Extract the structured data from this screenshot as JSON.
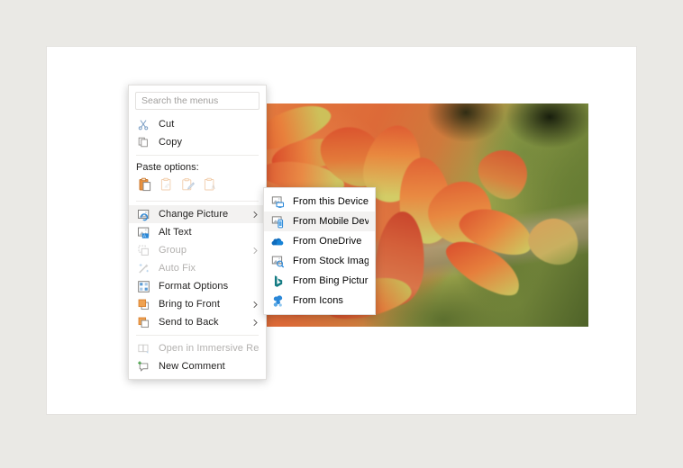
{
  "app": {
    "surface_color": "#eae9e5",
    "page_color": "#ffffff",
    "accent_blue": "#0078d4",
    "hover_gray": "#f3f2f1"
  },
  "picture": {
    "alt": "Close-up photograph of orange-red tipped succulent plants with blurred green foliage background",
    "selected": true
  },
  "context_menu": {
    "search": {
      "placeholder": "Search the menus",
      "value": ""
    },
    "items": [
      {
        "label": "Cut",
        "icon": "scissors-icon",
        "disabled": false,
        "submenu": false,
        "hovered": false
      },
      {
        "label": "Copy",
        "icon": "copy-icon",
        "disabled": false,
        "submenu": false,
        "hovered": false
      }
    ],
    "paste_options": {
      "label": "Paste options:",
      "buttons": [
        {
          "name": "paste-keep-source-formatting",
          "icon": "clipboard-paste-icon",
          "disabled": false
        },
        {
          "name": "paste-merge-formatting",
          "icon": "clipboard-merge-icon",
          "disabled": true
        },
        {
          "name": "paste-picture",
          "icon": "clipboard-picture-icon",
          "disabled": true
        },
        {
          "name": "paste-keep-text-only",
          "icon": "clipboard-text-icon",
          "disabled": true
        }
      ]
    },
    "actions": [
      {
        "label": "Change Picture",
        "icon": "change-picture-icon",
        "disabled": false,
        "submenu": true,
        "hovered": true
      },
      {
        "label": "Alt Text",
        "icon": "alt-text-icon",
        "disabled": false,
        "submenu": false,
        "hovered": false
      },
      {
        "label": "Group",
        "icon": "group-icon",
        "disabled": true,
        "submenu": true,
        "hovered": false
      },
      {
        "label": "Auto Fix",
        "icon": "auto-fix-icon",
        "disabled": true,
        "submenu": false,
        "hovered": false
      },
      {
        "label": "Format Options",
        "icon": "format-options-icon",
        "disabled": false,
        "submenu": false,
        "hovered": false
      },
      {
        "label": "Bring to Front",
        "icon": "bring-to-front-icon",
        "disabled": false,
        "submenu": true,
        "hovered": false
      },
      {
        "label": "Send to Back",
        "icon": "send-to-back-icon",
        "disabled": false,
        "submenu": true,
        "hovered": false
      }
    ],
    "footer": [
      {
        "label": "Open in Immersive Reader",
        "icon": "immersive-reader-icon",
        "disabled": true,
        "submenu": false,
        "hovered": false
      },
      {
        "label": "New Comment",
        "icon": "new-comment-icon",
        "disabled": false,
        "submenu": false,
        "hovered": false
      }
    ]
  },
  "submenu": {
    "title": "Change Picture",
    "items": [
      {
        "label": "From this Device...",
        "icon": "from-device-icon",
        "hovered": false
      },
      {
        "label": "From Mobile Device",
        "icon": "from-mobile-device-icon",
        "hovered": true
      },
      {
        "label": "From OneDrive",
        "icon": "onedrive-cloud-icon",
        "hovered": false
      },
      {
        "label": "From Stock Images",
        "icon": "stock-images-icon",
        "hovered": false
      },
      {
        "label": "From Bing Pictures",
        "icon": "bing-icon",
        "hovered": false
      },
      {
        "label": "From Icons",
        "icon": "from-icons-icon",
        "hovered": false
      }
    ]
  }
}
